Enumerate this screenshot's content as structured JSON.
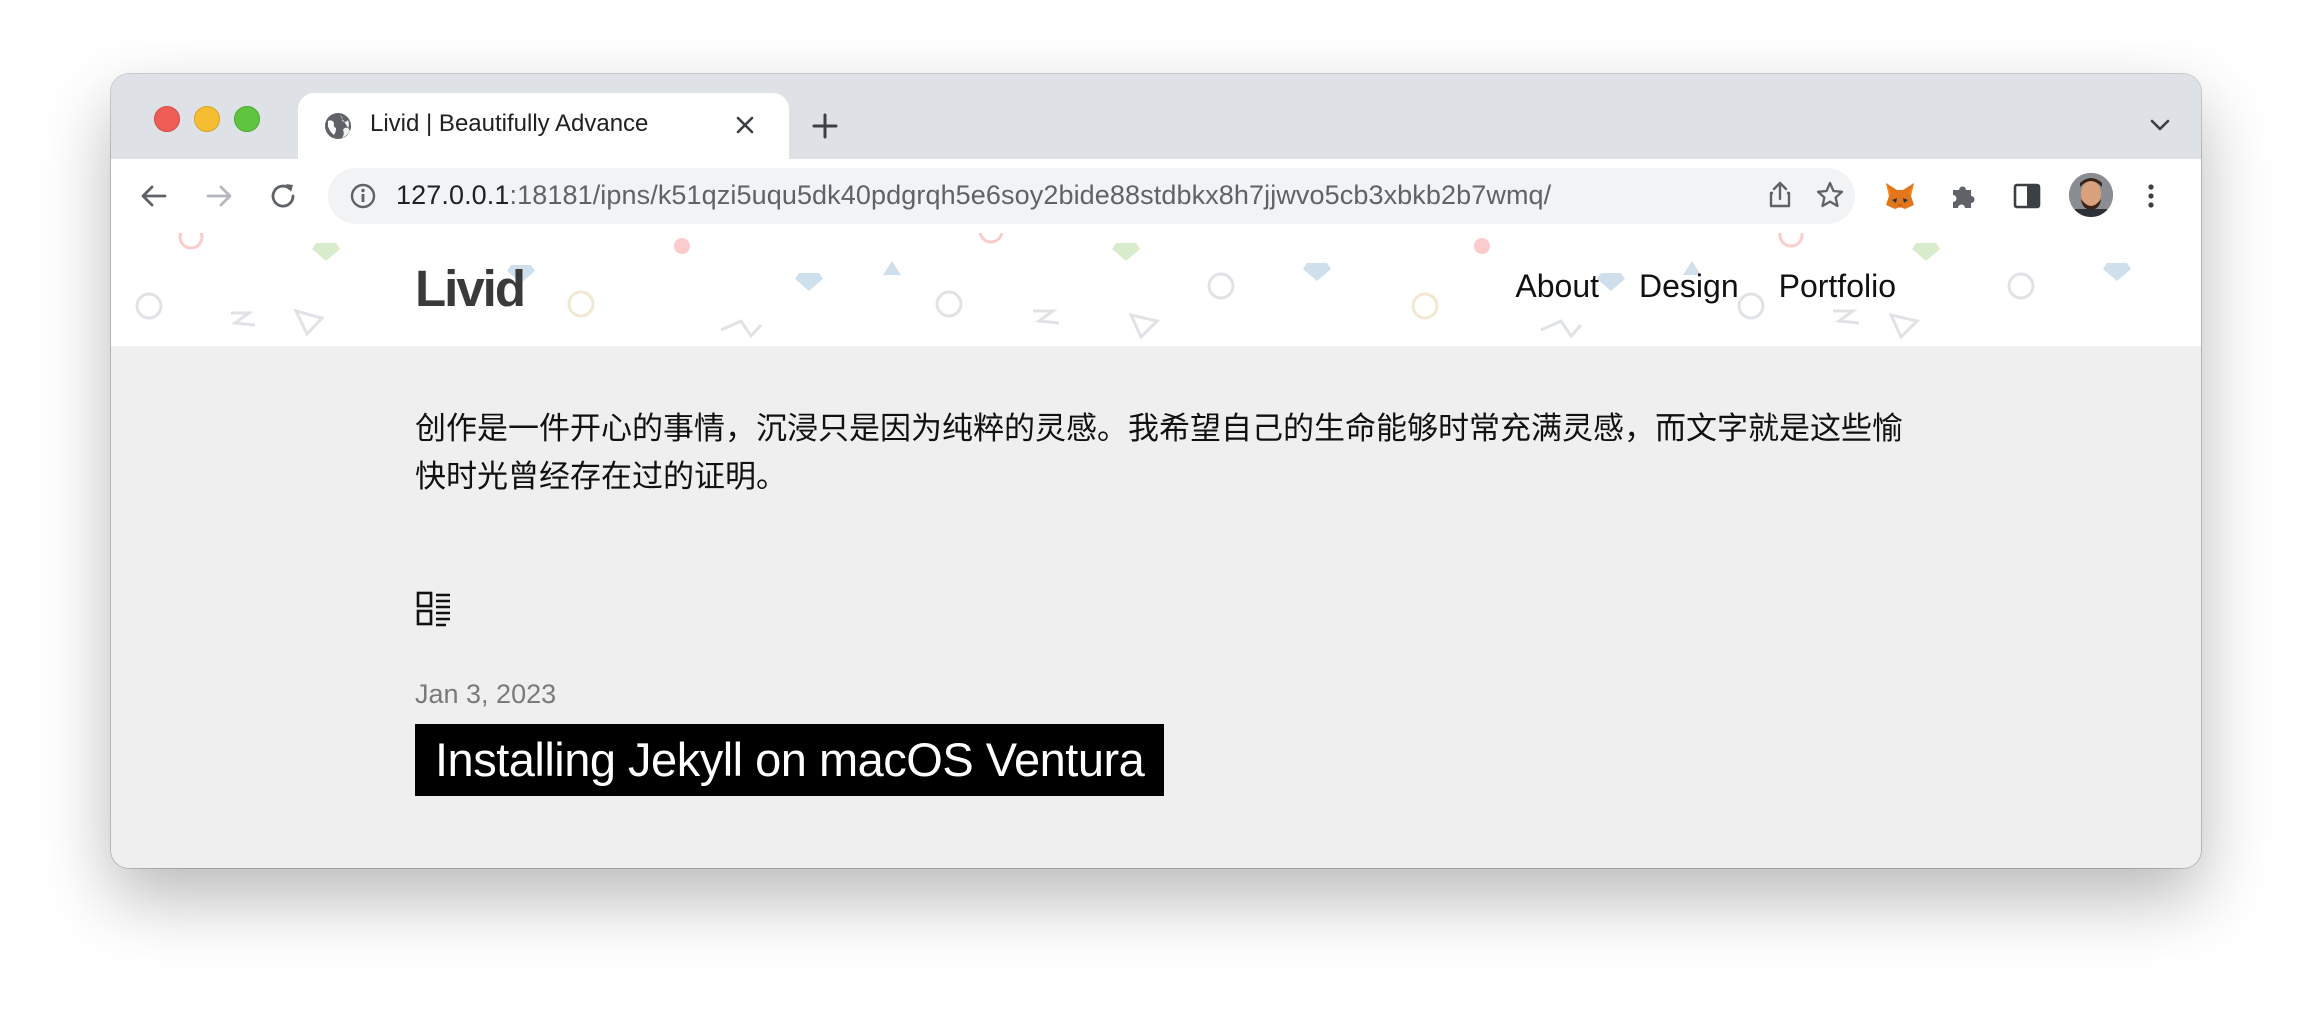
{
  "browser": {
    "tab": {
      "title": "Livid | Beautifully Advance"
    },
    "address": {
      "host": "127.0.0.1",
      "rest": ":18181/ipns/k51qzi5uqu5dk40pdgrqh5e6soy2bide88stdbkx8h7jjwvo5cb3xbkb2b7wmq/"
    }
  },
  "site": {
    "logo": "Livid",
    "nav": [
      "About",
      "Design",
      "Portfolio"
    ],
    "intro": "创作是一件开心的事情，沉浸只是因为纯粹的灵感。我希望自己的生命能够时常充满灵感，而文字就是这些愉快时光曾经存在过的证明。",
    "posts": [
      {
        "date": "Jan 3, 2023",
        "title": "Installing Jekyll on macOS Ventura"
      }
    ]
  },
  "colors": {
    "tab_strip": "#dee1e6",
    "page_bg": "#efeff0",
    "title_block_bg": "#000000"
  },
  "icons": [
    "globe-icon",
    "close-icon",
    "plus-icon",
    "chevron-down-icon",
    "back-arrow-icon",
    "forward-arrow-icon",
    "reload-icon",
    "info-icon",
    "share-icon",
    "star-icon",
    "fox-extension-icon",
    "puzzle-icon",
    "sidepanel-icon",
    "menu-dots-icon",
    "list-view-icon"
  ]
}
